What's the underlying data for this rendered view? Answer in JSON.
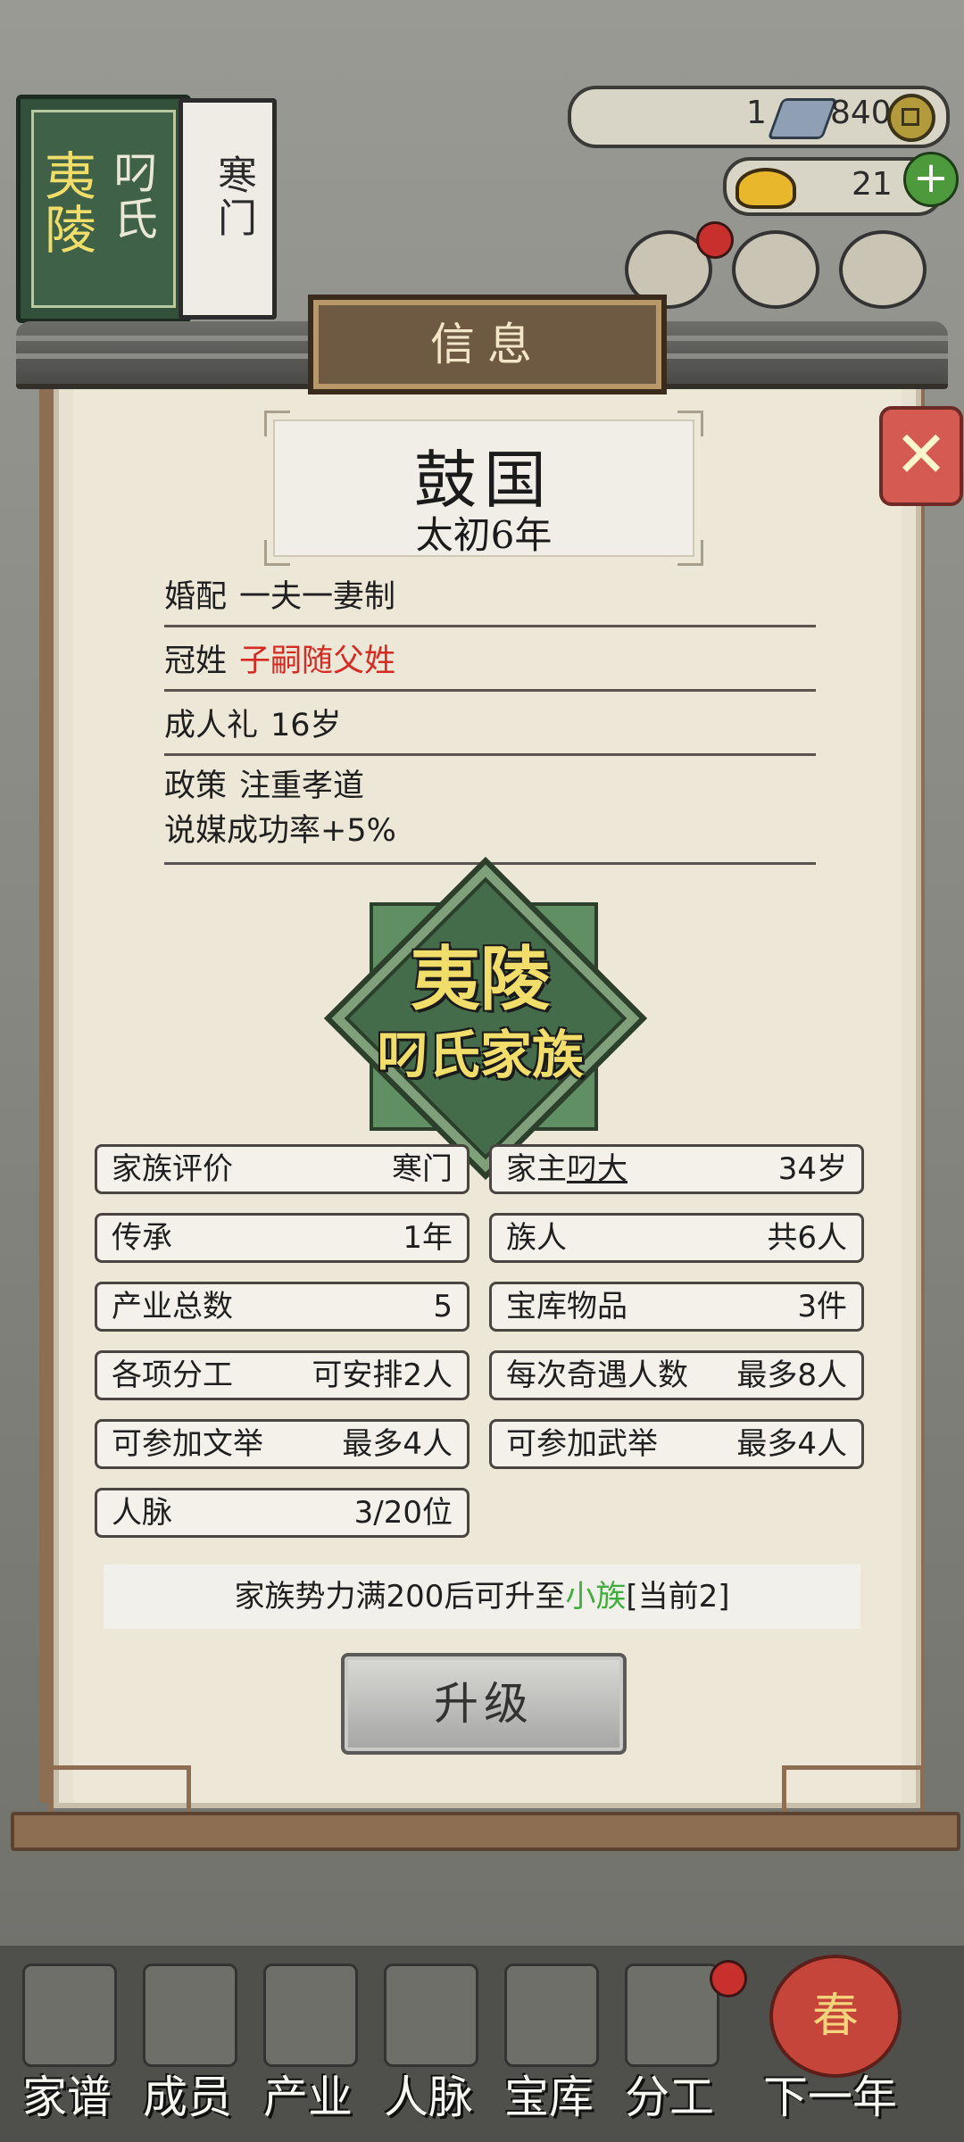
{
  "family_book": {
    "name": "夷陵叼氏",
    "status": "寒门"
  },
  "currency": {
    "silver": "1",
    "coins": "840",
    "gold": "21"
  },
  "modal": {
    "title": "信息",
    "country": "鼓国",
    "era": "太初6年",
    "rules": [
      {
        "label": "婚配",
        "value": "一夫一妻制"
      },
      {
        "label": "冠姓",
        "value": "子嗣随父姓",
        "color": "#d62b22"
      },
      {
        "label": "成人礼",
        "value": "16岁"
      },
      {
        "label": "政策",
        "value": "注重孝道",
        "extra": "说媒成功率+5%"
      }
    ],
    "emblem": {
      "line1": "夷陵",
      "line2": "叼氏家族"
    },
    "stats": [
      {
        "label": "家族评价",
        "value": "寒门"
      },
      {
        "label": "家主",
        "name": "叼大",
        "value": "34岁"
      },
      {
        "label": "传承",
        "value": "1年"
      },
      {
        "label": "族人",
        "value": "共6人"
      },
      {
        "label": "产业总数",
        "value": "5"
      },
      {
        "label": "宝库物品",
        "value": "3件"
      },
      {
        "label": "各项分工",
        "value": "可安排2人"
      },
      {
        "label": "每次奇遇人数",
        "value": "最多8人"
      },
      {
        "label": "可参加文举",
        "value": "最多4人"
      },
      {
        "label": "可参加武举",
        "value": "最多4人"
      },
      {
        "label": "人脉",
        "value": "3/20位"
      }
    ],
    "upgrade_note": {
      "prefix": "家族势力满200后可升至",
      "target": "小族",
      "suffix": "[当前2]",
      "target_color": "#3fae3c"
    },
    "upgrade_button": "升级"
  },
  "bottom_nav": [
    "家谱",
    "成员",
    "产业",
    "人脉",
    "宝库",
    "分工",
    "下一年"
  ],
  "next_year_badge": "春",
  "icons": {
    "close": "close-x-icon",
    "silver": "silver-ingot-icon",
    "coin": "copper-coin-icon",
    "gold": "gold-ingot-icon",
    "plus": "plus-icon"
  }
}
